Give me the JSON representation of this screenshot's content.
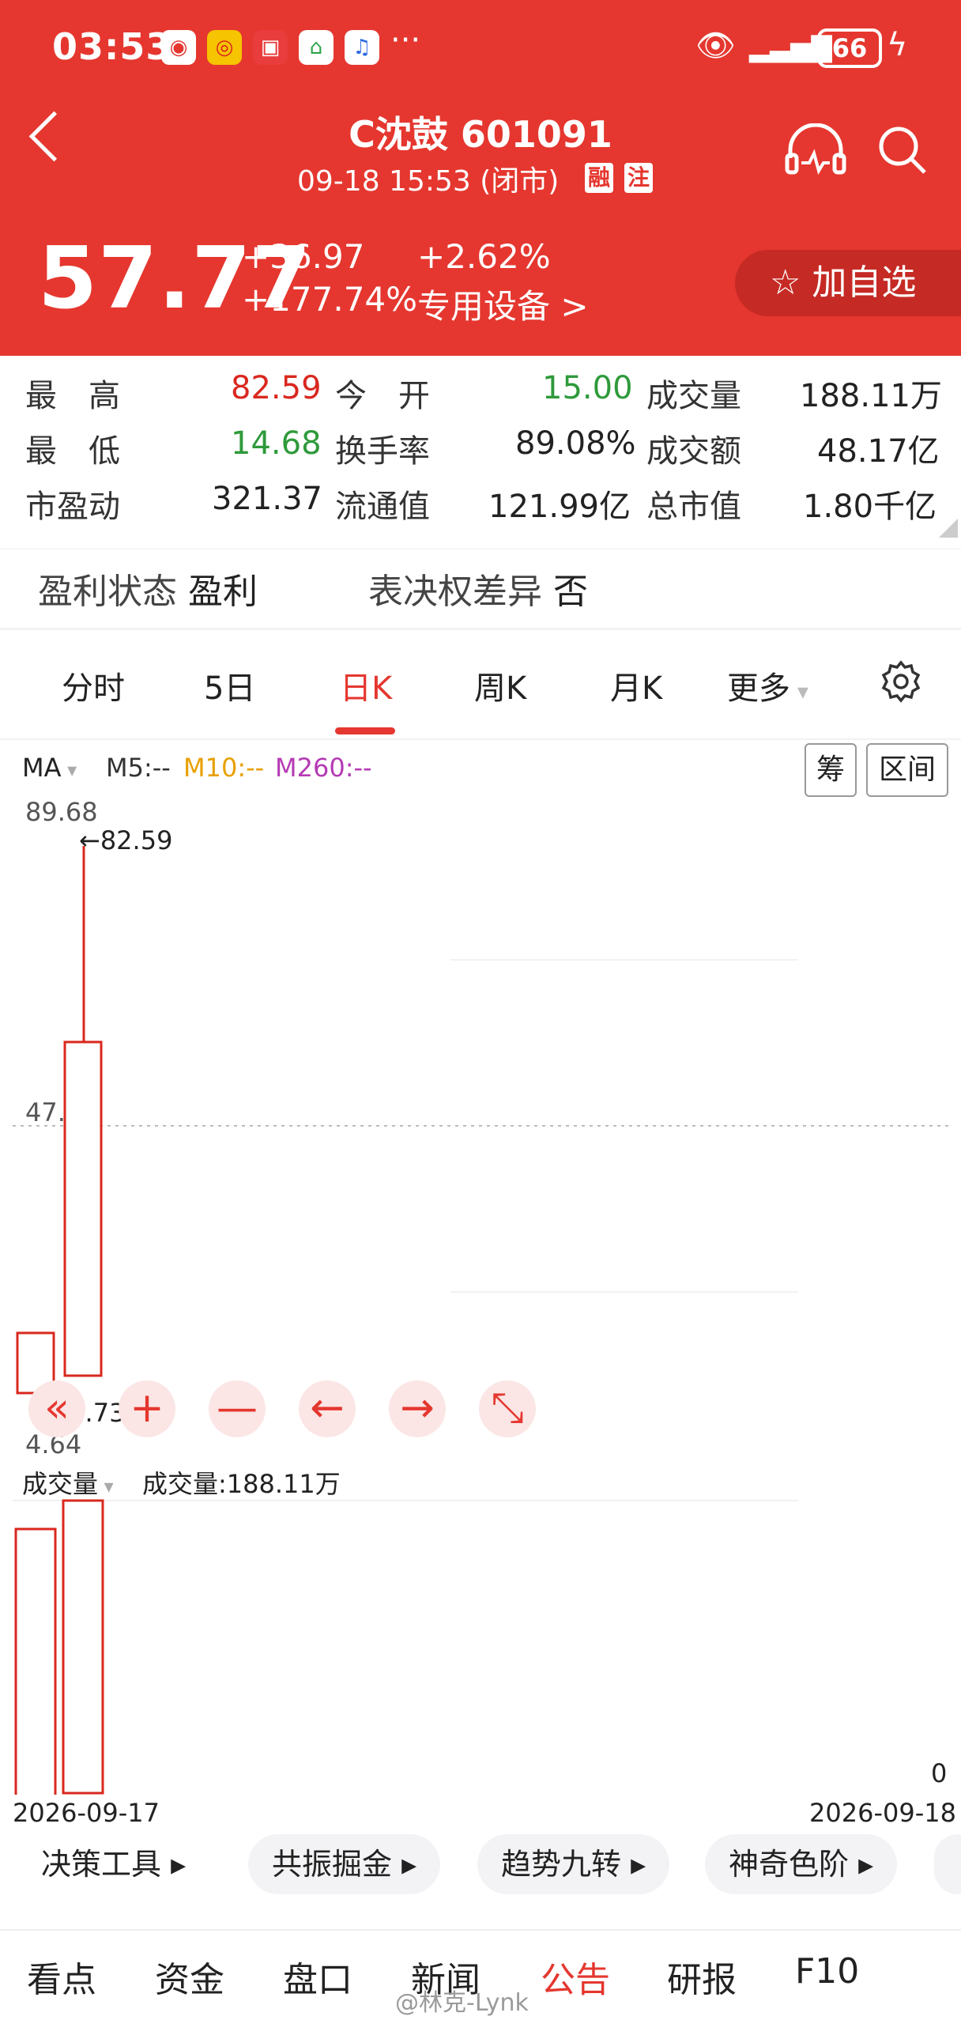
{
  "status_bar": {
    "time": "03:53",
    "more": "···",
    "battery": "66"
  },
  "header": {
    "title": "C沈鼓 601091",
    "datetime": "09-18 15:53 (闭市)",
    "tag_margin": "融",
    "tag_note": "注",
    "price": "57.77",
    "change_abs": "+36.97",
    "change_pct": "+177.74%",
    "sector_change": "+2.62%",
    "sector": "专用设备 >",
    "fav_button": "☆ 加自选",
    "accent_color": "#e5372f"
  },
  "stats": [
    [
      {
        "label": "最　高",
        "value": "82.59",
        "color": "red"
      },
      {
        "label": "今　开",
        "value": "15.00",
        "color": "green"
      },
      {
        "label": "成交量",
        "value": "188.11万",
        "color": "black"
      }
    ],
    [
      {
        "label": "最　低",
        "value": "14.68",
        "color": "green"
      },
      {
        "label": "换手率",
        "value": "89.08%",
        "color": "black"
      },
      {
        "label": "成交额",
        "value": "48.17亿",
        "color": "black"
      }
    ],
    [
      {
        "label": "市盈动",
        "value": "321.37",
        "color": "black"
      },
      {
        "label": "流通值",
        "value": "121.99亿",
        "color": "black"
      },
      {
        "label": "总市值",
        "value": "1.80千亿",
        "color": "black"
      }
    ]
  ],
  "profit": {
    "label": "盈利状态",
    "value": "盈利"
  },
  "voting": {
    "label": "表决权差异",
    "value": "否"
  },
  "chart_tabs": {
    "t0": "分时",
    "t1": "5日",
    "t2": "日K",
    "t3": "周K",
    "t4": "月K",
    "t5": "更多"
  },
  "ma": {
    "label": "MA",
    "m5": "M5:--",
    "m10": "M10:--",
    "m260": "M260:--",
    "btn_chip": "筹",
    "btn_range": "区间"
  },
  "chart_labels": {
    "y_top": "89.68",
    "y_mid": "47.16",
    "y_low": "4.64",
    "high_mark": "82.59",
    "low_mark": "11.73",
    "vol_label": "成交量",
    "vol_value": "成交量:188.11万",
    "vol_zero": "0",
    "date_left": "2026-09-17",
    "date_right": "2026-09-18"
  },
  "chart_data": {
    "type": "candlestick",
    "x": [
      "2026-09-17",
      "2026-09-18"
    ],
    "y_axis_ticks": [
      89.68,
      47.16,
      4.64
    ],
    "high_label": 82.59,
    "low_label": 11.73,
    "series_volume": "成交量:188.11万"
  },
  "zoom_controls": {
    "prev": "«",
    "plus": "+",
    "minus": "—",
    "left": "←",
    "right": "→",
    "full": "⤡"
  },
  "tools": {
    "t0": "决策工具 ▸",
    "t1": "共振掘金 ▸",
    "t2": "趋势九转 ▸",
    "t3": "神奇色阶 ▸"
  },
  "bottom_tabs": {
    "b0": "看点",
    "b1": "资金",
    "b2": "盘口",
    "b3": "新闻",
    "b4": "公告",
    "b5": "研报",
    "b6": "F10"
  },
  "watermark": "@林克-Lynk"
}
